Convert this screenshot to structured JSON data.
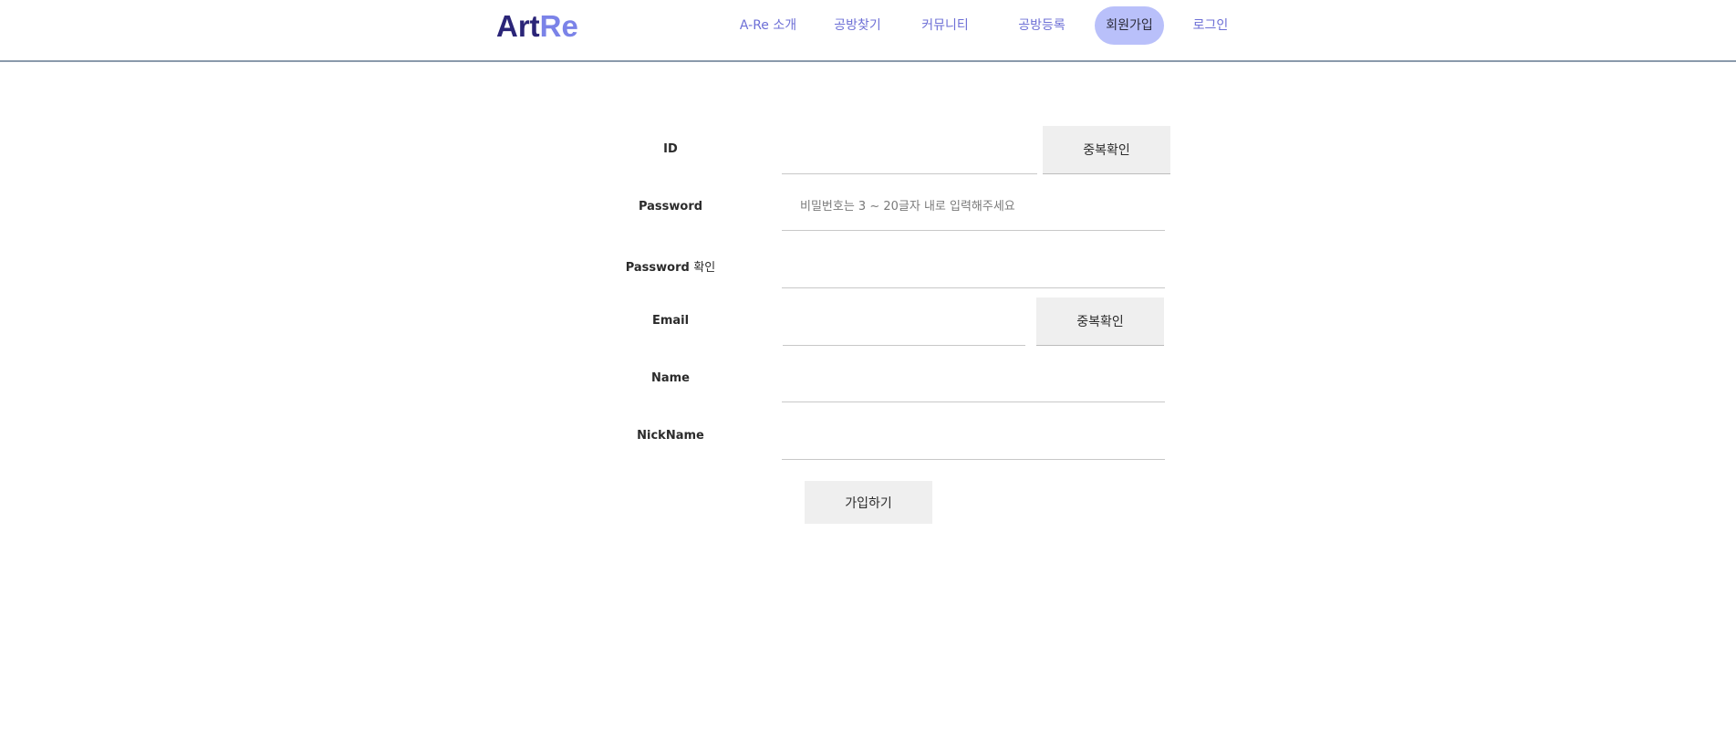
{
  "header": {
    "logo": {
      "part1": "Art",
      "part2": "Re"
    },
    "nav": [
      {
        "label": "A-Re 소개"
      },
      {
        "label": "공방찾기"
      },
      {
        "label": "커뮤니티"
      },
      {
        "label": "공방등록"
      },
      {
        "label": "회원가입",
        "active": true
      },
      {
        "label": "로그인"
      }
    ]
  },
  "form": {
    "id_label": "ID",
    "id_value": "",
    "id_check_button": "중복확인",
    "password_label": "Password",
    "password_placeholder": "비밀번호는 3 ~ 20글자 내로 입력해주세요",
    "password_confirm_label_en": "Password",
    "password_confirm_label_ko": "확인",
    "email_label": "Email",
    "email_check_button": "중복확인",
    "name_label": "Name",
    "nickname_label": "NickName",
    "submit_button": "가입하기"
  },
  "colors": {
    "logo_dark": "#2b2578",
    "logo_light": "#7b83e8",
    "nav_text": "#6d6fd6",
    "nav_active_bg": "#b9c0fa",
    "header_border": "#8a9aab",
    "button_bg": "#efefef"
  }
}
